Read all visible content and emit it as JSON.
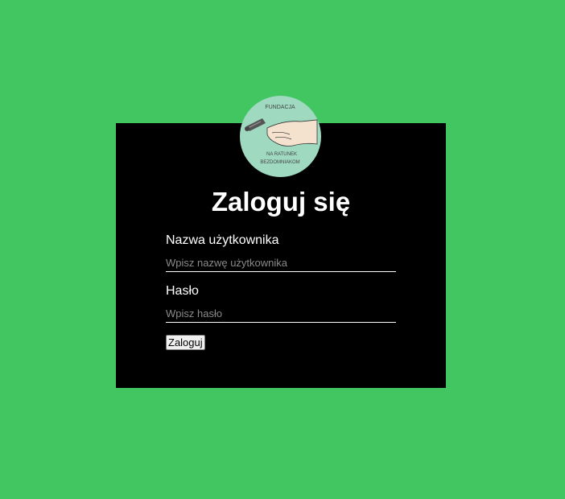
{
  "logo": {
    "text_top": "FUNDACJA",
    "text_mid": "NA RATUNEK",
    "text_bottom": "BEZDOMNIAKOM"
  },
  "form": {
    "title": "Zaloguj się",
    "username_label": "Nazwa użytkownika",
    "username_placeholder": "Wpisz nazwę użytkownika",
    "username_value": "",
    "password_label": "Hasło",
    "password_placeholder": "Wpisz hasło",
    "password_value": "",
    "submit_label": "Zaloguj"
  },
  "colors": {
    "background": "#41c662",
    "panel": "#000000",
    "logo_bg": "#9fd9c0"
  }
}
